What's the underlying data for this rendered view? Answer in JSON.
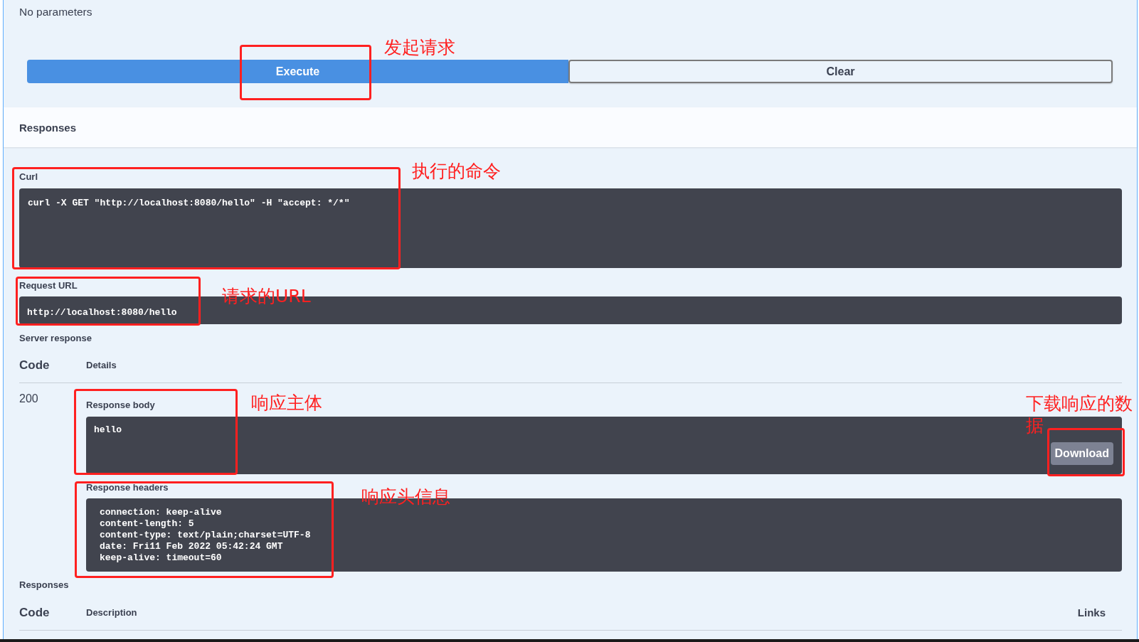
{
  "parameters": {
    "message": "No parameters"
  },
  "buttons": [
    {
      "label": "Execute",
      "kind": "primary"
    },
    {
      "label": "Clear",
      "kind": "secondary"
    }
  ],
  "responses_header": {
    "title": "Responses"
  },
  "curl": {
    "label": "Curl",
    "command": "curl -X GET \"http://localhost:8080/hello\" -H \"accept: */*\""
  },
  "request_url": {
    "label": "Request URL",
    "url": "http://localhost:8080/hello"
  },
  "server_response": {
    "title": "Server response",
    "columns": [
      "Code",
      "Details"
    ],
    "code": "200",
    "response_body": {
      "label": "Response body",
      "content": "hello",
      "download_button": "Download"
    },
    "response_headers": {
      "label": "Response headers",
      "lines": [
        "connection: keep-alive",
        "content-length: 5",
        "content-type: text/plain;charset=UTF-8",
        "date: Fri11 Feb 2022 05:42:24 GMT",
        "keep-alive: timeout=60"
      ]
    }
  },
  "responses": {
    "title": "Responses",
    "columns": [
      "Code",
      "Description",
      "Links"
    ]
  },
  "annotations": [
    {
      "text": "发起请求"
    },
    {
      "text": "执行的命令"
    },
    {
      "text": "请求的URL"
    },
    {
      "text": "响应主体"
    },
    {
      "text": "下载响应的数据"
    },
    {
      "text": "响应头信息"
    }
  ]
}
